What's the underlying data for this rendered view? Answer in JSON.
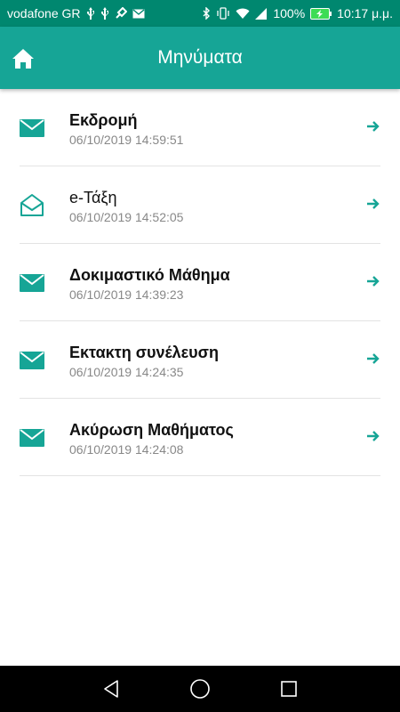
{
  "status_bar": {
    "carrier": "vodafone GR",
    "battery": "100%",
    "time": "10:17 μ.μ.",
    "left_icons": [
      "usb-icon",
      "usb-icon",
      "gamepad-icon",
      "mail-icon"
    ],
    "right_icons": [
      "bluetooth-icon",
      "vibrate-icon",
      "wifi-icon",
      "signal-icon",
      "battery-charging-icon"
    ]
  },
  "app_bar": {
    "title": "Μηνύματα",
    "home_icon": "home-icon",
    "background": "#16a596"
  },
  "messages": [
    {
      "subject": "Εκδρομή",
      "time": "06/10/2019 14:59:51",
      "read": false
    },
    {
      "subject": "e-Τάξη",
      "time": "06/10/2019 14:52:05",
      "read": true
    },
    {
      "subject": "Δοκιμαστικό Μάθημα",
      "time": "06/10/2019 14:39:23",
      "read": false
    },
    {
      "subject": "Εκτακτη συνέλευση",
      "time": "06/10/2019 14:24:35",
      "read": false
    },
    {
      "subject": "Ακύρωση Μαθήματος",
      "time": "06/10/2019 14:24:08",
      "read": false
    }
  ],
  "colors": {
    "accent": "#16a596",
    "status_bar": "#00876f"
  },
  "nav_bar": {
    "icons": [
      "back-icon",
      "home-circle-icon",
      "recents-icon"
    ]
  }
}
